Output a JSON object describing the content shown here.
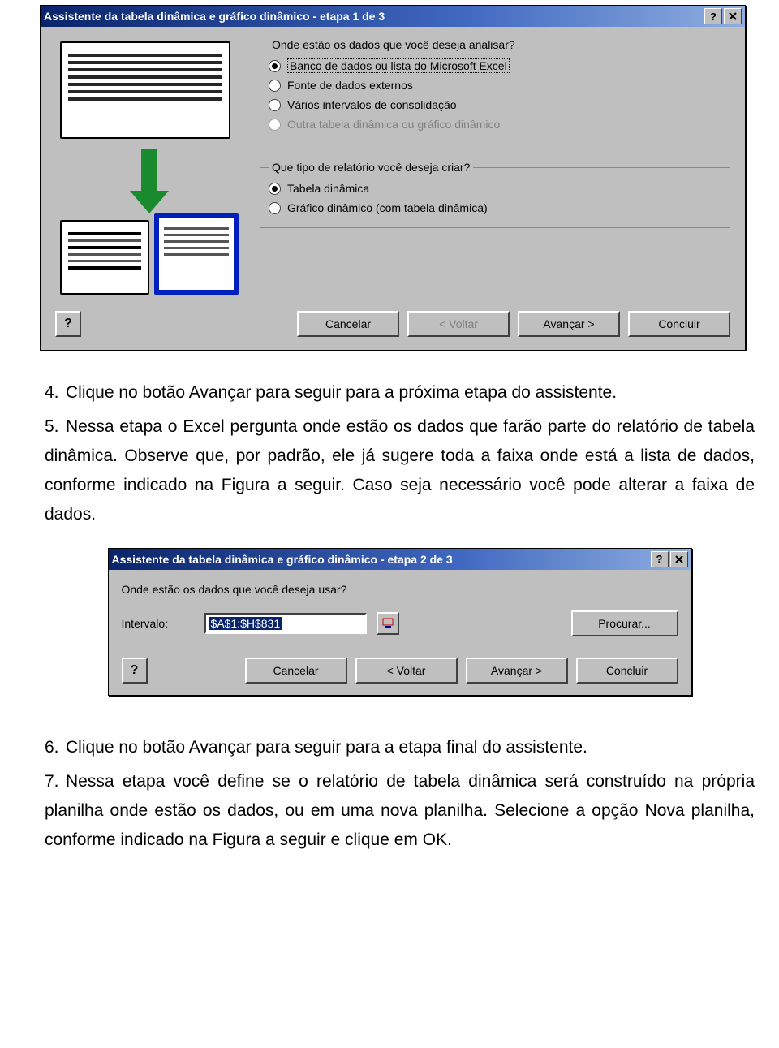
{
  "dialog1": {
    "title": "Assistente da tabela dinâmica e gráfico dinâmico - etapa 1 de 3",
    "group1": {
      "legend": "Onde estão os dados que você deseja analisar?",
      "opt1": "Banco de dados ou lista do Microsoft Excel",
      "opt2": "Fonte de dados externos",
      "opt3": "Vários intervalos de consolidação",
      "opt4": "Outra tabela dinâmica ou gráfico dinâmico"
    },
    "group2": {
      "legend": "Que tipo de relatório você deseja criar?",
      "opt1": "Tabela dinâmica",
      "opt2": "Gráfico dinâmico (com tabela dinâmica)"
    },
    "buttons": {
      "cancel": "Cancelar",
      "back": "< Voltar",
      "next": "Avançar >",
      "finish": "Concluir"
    }
  },
  "text": {
    "p4": "Clique no botão Avançar para seguir para a próxima etapa do assistente.",
    "p5": "Nessa etapa o Excel pergunta onde estão os dados que farão parte do relatório de tabela dinâmica. Observe que, por padrão, ele já sugere toda a faixa onde está a lista de dados, conforme indicado na Figura a seguir. Caso seja necessário você pode alterar a faixa de dados.",
    "p6": "Clique no botão Avançar para seguir para a etapa final do assistente.",
    "p7": "Nessa etapa você define se o relatório de tabela dinâmica será construído na própria planilha onde estão os dados, ou em uma nova planilha. Selecione a opção Nova planilha, conforme indicado na Figura a seguir e clique em OK.",
    "n4": "4.",
    "n5": "5.",
    "n6": "6.",
    "n7": "7."
  },
  "dialog2": {
    "title": "Assistente da tabela dinâmica e gráfico dinâmico - etapa 2 de 3",
    "prompt": "Onde estão os dados que você deseja usar?",
    "interval_label": "Intervalo:",
    "interval_value": "$A$1:$H$831",
    "browse": "Procurar...",
    "buttons": {
      "cancel": "Cancelar",
      "back": "< Voltar",
      "next": "Avançar >",
      "finish": "Concluir"
    }
  }
}
